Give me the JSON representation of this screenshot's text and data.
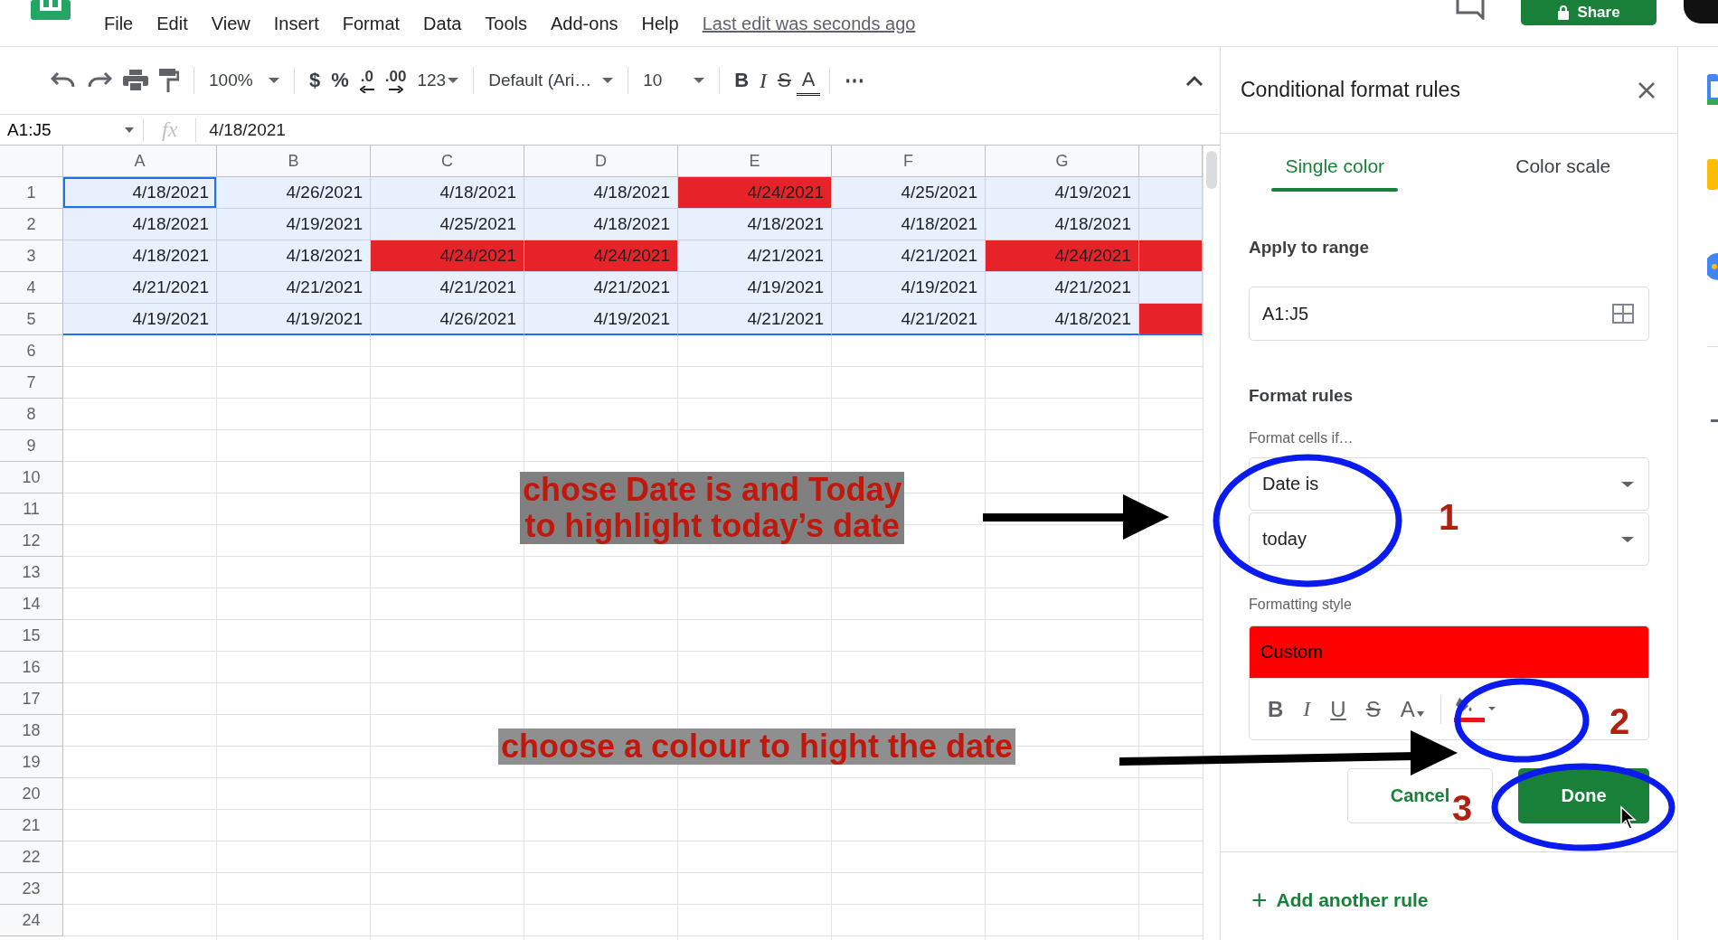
{
  "topbar": {
    "menu": [
      "File",
      "Edit",
      "View",
      "Insert",
      "Format",
      "Data",
      "Tools",
      "Add-ons",
      "Help"
    ],
    "last_edit": "Last edit was seconds ago",
    "share": "Share"
  },
  "toolbar": {
    "zoom": "100%",
    "currency": "$",
    "percent": "%",
    "decimal_less": ".0",
    "decimal_more": ".00",
    "number_format": "123",
    "font": "Default (Ari…",
    "font_size": "10",
    "bold": "B",
    "italic": "I",
    "strikethrough": "S",
    "text_color": "A",
    "more": "⋯"
  },
  "formula_bar": {
    "name_box": "A1:J5",
    "fx": "fx",
    "value": "4/18/2021"
  },
  "sheet": {
    "columns": [
      "A",
      "B",
      "C",
      "D",
      "E",
      "F",
      "G"
    ],
    "row_numbers": [
      "1",
      "2",
      "3",
      "4",
      "5",
      "6",
      "7",
      "8",
      "9",
      "10",
      "11",
      "12",
      "13",
      "14",
      "15",
      "16",
      "17",
      "18",
      "19",
      "20",
      "21",
      "22",
      "23",
      "24"
    ],
    "rows": [
      {
        "selected": true,
        "cells": [
          {
            "text": "4/18/2021",
            "highlighted": false,
            "active": true
          },
          {
            "text": "4/26/2021",
            "highlighted": false,
            "active": false
          },
          {
            "text": "4/18/2021",
            "highlighted": false,
            "active": false
          },
          {
            "text": "4/18/2021",
            "highlighted": false,
            "active": false
          },
          {
            "text": "4/24/2021",
            "highlighted": true,
            "active": false
          },
          {
            "text": "4/25/2021",
            "highlighted": false,
            "active": false
          },
          {
            "text": "4/19/2021",
            "highlighted": false,
            "active": false
          },
          {
            "highlighted": false,
            "active": false
          }
        ]
      },
      {
        "selected": true,
        "cells": [
          {
            "text": "4/18/2021",
            "highlighted": false,
            "active": false
          },
          {
            "text": "4/19/2021",
            "highlighted": false,
            "active": false
          },
          {
            "text": "4/25/2021",
            "highlighted": false,
            "active": false
          },
          {
            "text": "4/18/2021",
            "highlighted": false,
            "active": false
          },
          {
            "text": "4/18/2021",
            "highlighted": false,
            "active": false
          },
          {
            "text": "4/18/2021",
            "highlighted": false,
            "active": false
          },
          {
            "text": "4/18/2021",
            "highlighted": false,
            "active": false
          },
          {
            "highlighted": false,
            "active": false
          }
        ]
      },
      {
        "selected": true,
        "cells": [
          {
            "text": "4/18/2021",
            "highlighted": false,
            "active": false
          },
          {
            "text": "4/18/2021",
            "highlighted": false,
            "active": false
          },
          {
            "text": "4/24/2021",
            "highlighted": true,
            "active": false
          },
          {
            "text": "4/24/2021",
            "highlighted": true,
            "active": false
          },
          {
            "text": "4/21/2021",
            "highlighted": false,
            "active": false
          },
          {
            "text": "4/21/2021",
            "highlighted": false,
            "active": false
          },
          {
            "text": "4/24/2021",
            "highlighted": true,
            "active": false
          },
          {
            "highlighted": true,
            "active": false
          }
        ]
      },
      {
        "selected": true,
        "cells": [
          {
            "text": "4/21/2021",
            "highlighted": false,
            "active": false
          },
          {
            "text": "4/21/2021",
            "highlighted": false,
            "active": false
          },
          {
            "text": "4/21/2021",
            "highlighted": false,
            "active": false
          },
          {
            "text": "4/21/2021",
            "highlighted": false,
            "active": false
          },
          {
            "text": "4/19/2021",
            "highlighted": false,
            "active": false
          },
          {
            "text": "4/19/2021",
            "highlighted": false,
            "active": false
          },
          {
            "text": "4/21/2021",
            "highlighted": false,
            "active": false
          },
          {
            "highlighted": false,
            "active": false
          }
        ]
      },
      {
        "selected": true,
        "cells": [
          {
            "text": "4/19/2021",
            "highlighted": false,
            "active": false
          },
          {
            "text": "4/19/2021",
            "highlighted": false,
            "active": false
          },
          {
            "text": "4/26/2021",
            "highlighted": false,
            "active": false
          },
          {
            "text": "4/19/2021",
            "highlighted": false,
            "active": false
          },
          {
            "text": "4/21/2021",
            "highlighted": false,
            "active": false
          },
          {
            "text": "4/21/2021",
            "highlighted": false,
            "active": false
          },
          {
            "text": "4/18/2021",
            "highlighted": false,
            "active": false
          },
          {
            "highlighted": true,
            "active": false
          }
        ]
      }
    ]
  },
  "panel": {
    "title": "Conditional format rules",
    "tabs": [
      {
        "label": "Single color",
        "selected": true
      },
      {
        "label": "Color scale",
        "selected": false
      }
    ],
    "apply_label": "Apply to range",
    "range": "A1:J5",
    "format_rules_label": "Format rules",
    "condition_label": "Format cells if…",
    "condition_dropdowns": [
      {
        "value": "Date is"
      },
      {
        "value": "today"
      }
    ],
    "style_label": "Formatting style",
    "style_preview": "Custom",
    "style_tools": {
      "bold": "B",
      "italic": "I",
      "underline": "U",
      "strikethrough": "S",
      "text_color": "A"
    },
    "buttons": [
      {
        "label": "Cancel",
        "kind": "secondary"
      },
      {
        "label": "Done",
        "kind": "primary"
      }
    ],
    "add_rule": {
      "icon": "+",
      "label": "Add another rule"
    }
  },
  "annotations": {
    "callouts": [
      {
        "text": "chose Date is and Today\nto highlight today’s date"
      },
      {
        "text": "choose a colour to hight the date"
      }
    ],
    "step_numbers": [
      "1",
      "2",
      "3"
    ]
  }
}
